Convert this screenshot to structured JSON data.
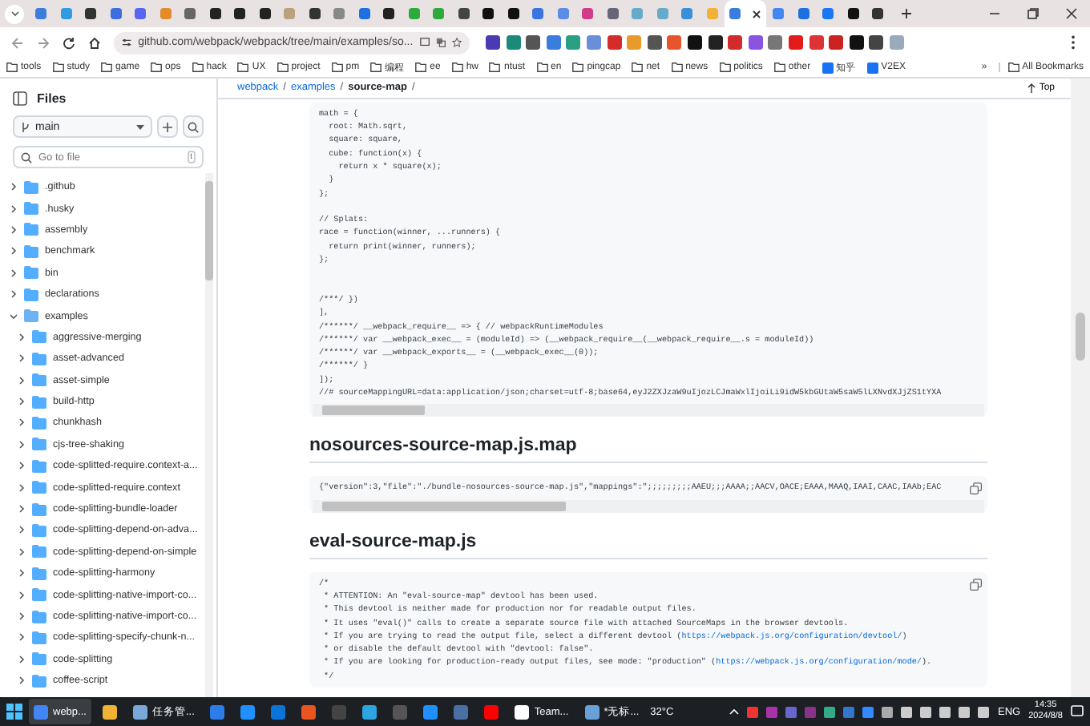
{
  "browser": {
    "tabs": [
      {
        "selected": false
      },
      {
        "selected": false
      },
      {
        "selected": false
      },
      {
        "selected": false
      },
      {
        "selected": false
      },
      {
        "selected": false
      },
      {
        "selected": false
      },
      {
        "selected": false
      },
      {
        "selected": false
      },
      {
        "selected": false
      },
      {
        "selected": false
      },
      {
        "selected": false
      },
      {
        "selected": false
      },
      {
        "selected": false
      },
      {
        "selected": false
      },
      {
        "selected": false
      },
      {
        "selected": false
      },
      {
        "selected": false
      },
      {
        "selected": false
      },
      {
        "selected": false
      },
      {
        "selected": false
      },
      {
        "selected": false
      },
      {
        "selected": false
      },
      {
        "selected": false
      },
      {
        "selected": false
      },
      {
        "selected": false
      },
      {
        "selected": false
      },
      {
        "selected": false
      },
      {
        "selected": true
      },
      {
        "selected": false
      },
      {
        "selected": false
      },
      {
        "selected": false
      },
      {
        "selected": false
      },
      {
        "selected": false
      }
    ],
    "address": "github.com/webpack/webpack/tree/main/examples/so...",
    "bookmarks": [
      {
        "label": "tools",
        "kind": "folder"
      },
      {
        "label": "study",
        "kind": "folder"
      },
      {
        "label": "game",
        "kind": "folder"
      },
      {
        "label": "ops",
        "kind": "folder"
      },
      {
        "label": "hack",
        "kind": "folder"
      },
      {
        "label": "UX",
        "kind": "folder"
      },
      {
        "label": "project",
        "kind": "folder"
      },
      {
        "label": "pm",
        "kind": "folder"
      },
      {
        "label": "编程",
        "kind": "folder"
      },
      {
        "label": "ee",
        "kind": "folder"
      },
      {
        "label": "hw",
        "kind": "folder"
      },
      {
        "label": "ntust",
        "kind": "folder"
      },
      {
        "label": "en",
        "kind": "folder"
      },
      {
        "label": "pingcap",
        "kind": "folder"
      },
      {
        "label": "net",
        "kind": "folder"
      },
      {
        "label": "news",
        "kind": "folder"
      },
      {
        "label": "politics",
        "kind": "folder"
      },
      {
        "label": "other",
        "kind": "folder"
      },
      {
        "label": "知乎",
        "kind": "site"
      },
      {
        "label": "V2EX",
        "kind": "site"
      }
    ],
    "more_bookmarks": "»",
    "all_bookmarks": "All Bookmarks"
  },
  "sidebar": {
    "title": "Files",
    "branch": "main",
    "search_placeholder": "Go to file",
    "search_shortcut": "t",
    "tree": [
      {
        "name": ".github",
        "expanded": false
      },
      {
        "name": ".husky",
        "expanded": false
      },
      {
        "name": "assembly",
        "expanded": false
      },
      {
        "name": "benchmark",
        "expanded": false
      },
      {
        "name": "bin",
        "expanded": false
      },
      {
        "name": "declarations",
        "expanded": false
      },
      {
        "name": "examples",
        "expanded": true,
        "children": [
          {
            "name": "aggressive-merging",
            "expanded": false
          },
          {
            "name": "asset-advanced",
            "expanded": false
          },
          {
            "name": "asset-simple",
            "expanded": false
          },
          {
            "name": "build-http",
            "expanded": false
          },
          {
            "name": "chunkhash",
            "expanded": false
          },
          {
            "name": "cjs-tree-shaking",
            "expanded": false
          },
          {
            "name": "code-splitted-require.context-a...",
            "expanded": false
          },
          {
            "name": "code-splitted-require.context",
            "expanded": false
          },
          {
            "name": "code-splitting-bundle-loader",
            "expanded": false
          },
          {
            "name": "code-splitting-depend-on-adva...",
            "expanded": false
          },
          {
            "name": "code-splitting-depend-on-simple",
            "expanded": false
          },
          {
            "name": "code-splitting-harmony",
            "expanded": false
          },
          {
            "name": "code-splitting-native-import-co...",
            "expanded": false
          },
          {
            "name": "code-splitting-native-import-co...",
            "expanded": false
          },
          {
            "name": "code-splitting-specify-chunk-n...",
            "expanded": false
          },
          {
            "name": "code-splitting",
            "expanded": false
          },
          {
            "name": "coffee-script",
            "expanded": false
          }
        ]
      }
    ]
  },
  "breadcrumb": [
    {
      "label": "webpack",
      "separator": "/"
    },
    {
      "label": "examples",
      "separator": "/"
    },
    {
      "label": "source-map",
      "separator": "/"
    }
  ],
  "top_link": "Top",
  "sections": [
    {
      "kind": "code",
      "copy": false,
      "lines": [
        {
          "kind": "code",
          "text": "math = {"
        },
        {
          "kind": "code",
          "text": "  root: Math.sqrt,"
        },
        {
          "kind": "code",
          "text": "  square: square,"
        },
        {
          "kind": "code",
          "text": "  cube: function(x) {"
        },
        {
          "kind": "code",
          "text": "    return x * square(x);"
        },
        {
          "kind": "code",
          "text": "  }"
        },
        {
          "kind": "code",
          "text": "};"
        },
        {
          "kind": "blank"
        },
        {
          "kind": "code",
          "text": "// Splats:"
        },
        {
          "kind": "code",
          "text": "race = function(winner, ...runners) {"
        },
        {
          "kind": "code",
          "text": "  return print(winner, runners);"
        },
        {
          "kind": "code",
          "text": "};"
        },
        {
          "kind": "blank"
        },
        {
          "kind": "blank"
        },
        {
          "kind": "code",
          "text": "/***/ })"
        },
        {
          "kind": "code",
          "text": "],"
        },
        {
          "kind": "code",
          "text": "/******/ __webpack_require__ => { // webpackRuntimeModules"
        },
        {
          "kind": "code",
          "text": "/******/ var __webpack_exec__ = (moduleId) => (__webpack_require__(__webpack_require__.s = moduleId))"
        },
        {
          "kind": "code",
          "text": "/******/ var __webpack_exports__ = (__webpack_exec__(0));"
        },
        {
          "kind": "code",
          "text": "/******/ }"
        },
        {
          "kind": "code",
          "text": "]);"
        },
        {
          "kind": "code",
          "text": "//# sourceMappingURL=data:application/json;charset=utf-8;base64,eyJ2ZXJzaW9uIjozLCJmaWxlIjoiLi9idW5kbGUtaW5saW5lLXNvdXJjZS1tYXA"
        }
      ]
    },
    {
      "kind": "heading",
      "text": "nosources-source-map.js.map"
    },
    {
      "kind": "code",
      "copy": true,
      "lines": [
        {
          "kind": "code",
          "text": "{\"version\":3,\"file\":\"./bundle-nosources-source-map.js\",\"mappings\":\";;;;;;;;;AAEU;;;AAAA;;AACV,OACE;EAAA,MAAQ,IAAI,CAAC,IAAb;EAC"
        }
      ]
    },
    {
      "kind": "heading",
      "text": "eval-source-map.js"
    },
    {
      "kind": "code",
      "copy": true,
      "lines": [
        {
          "kind": "code",
          "text": "/*"
        },
        {
          "kind": "code",
          "text": " * ATTENTION: An \"eval-source-map\" devtool has been used."
        },
        {
          "kind": "code",
          "text": " * This devtool is neither made for production nor for readable output files."
        },
        {
          "kind": "code",
          "text": " * It uses \"eval()\" calls to create a separate source file with attached SourceMaps in the browser devtools."
        },
        {
          "kind": "link",
          "text": " * If you are trying to read the output file, select a different devtool (",
          "link": "https://webpack.js.org/configuration/devtool/",
          "tail": ")"
        },
        {
          "kind": "code",
          "text": " * or disable the default devtool with \"devtool: false\"."
        },
        {
          "kind": "link",
          "text": " * If you are looking for production-ready output files, see mode: \"production\" (",
          "link": "https://webpack.js.org/configuration/mode/",
          "tail": ")."
        },
        {
          "kind": "code",
          "text": " */"
        }
      ]
    }
  ],
  "taskbar": {
    "apps": [
      {
        "label": "webp...",
        "selected": true
      },
      {
        "selected": false
      },
      {
        "label": "任务管...",
        "selected": false
      },
      {
        "selected": false
      },
      {
        "selected": false
      },
      {
        "selected": false
      },
      {
        "selected": false
      },
      {
        "selected": false
      },
      {
        "selected": false
      },
      {
        "selected": false
      },
      {
        "selected": false
      },
      {
        "selected": false
      },
      {
        "selected": false
      },
      {
        "label": "Team...",
        "selected": false
      },
      {
        "label": "*无标...",
        "selected": false
      }
    ],
    "weather": "32°C",
    "language": "ENG",
    "time": "14:35",
    "date": "2024/8/8"
  }
}
